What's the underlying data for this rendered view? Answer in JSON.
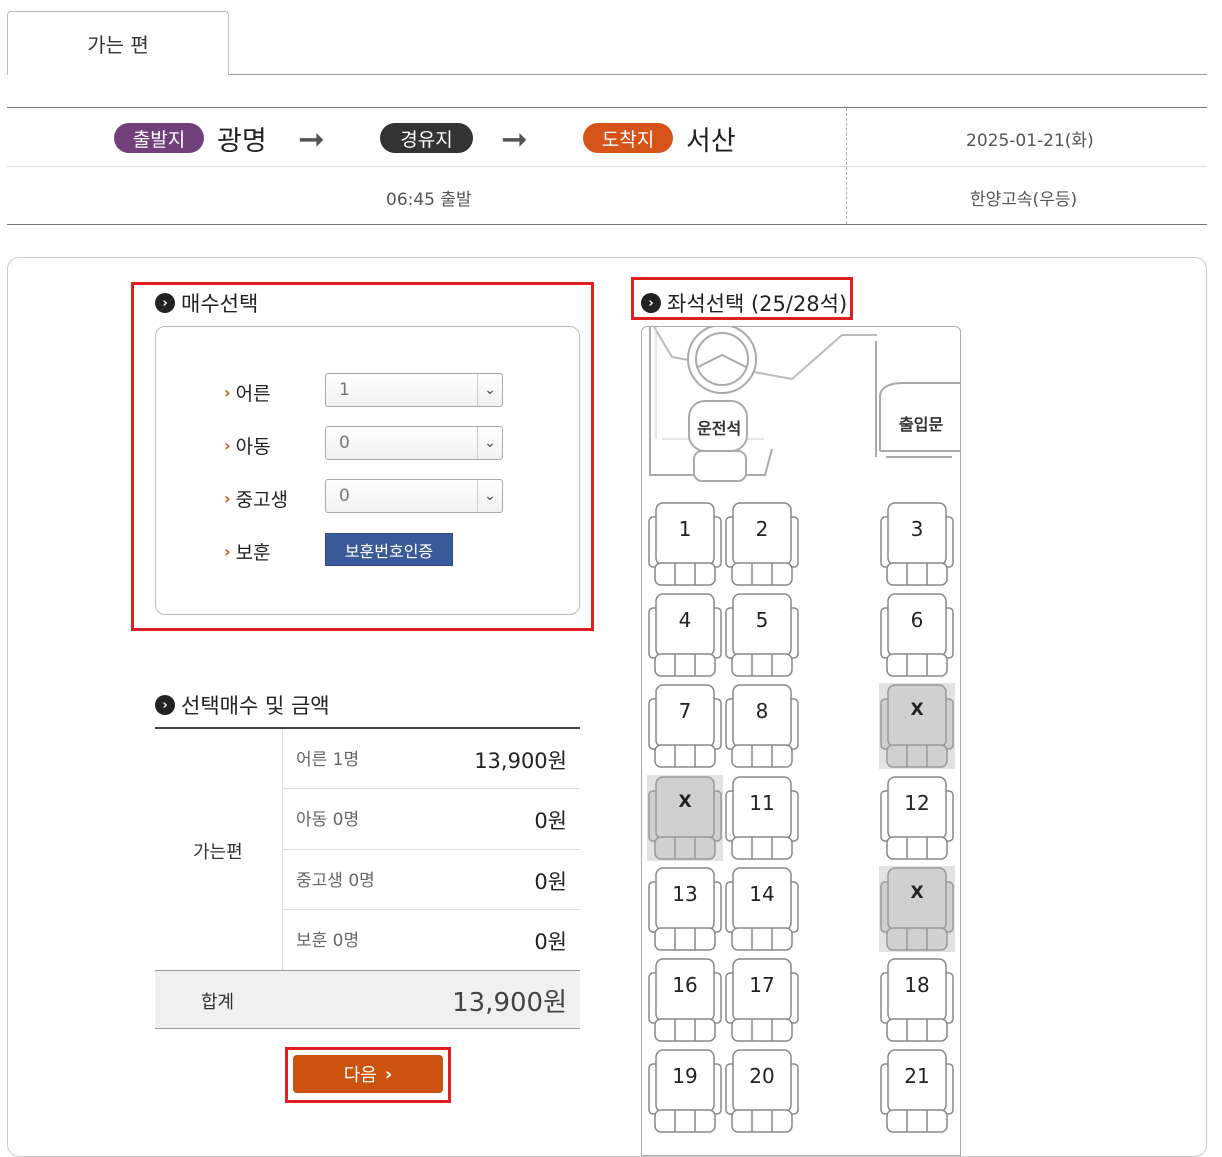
{
  "tab": {
    "label": "가는 편"
  },
  "route": {
    "departure_badge": "출발지",
    "departure": "광명",
    "via_badge": "경유지",
    "arrival_badge": "도착지",
    "arrival": "서산",
    "date": "2025-01-21(화)",
    "time": "06:45 출발",
    "company": "한양고속(우등)",
    "arrow": "➞"
  },
  "quantity": {
    "title": "매수선택",
    "rows": [
      {
        "label": "어른",
        "value": "1"
      },
      {
        "label": "아동",
        "value": "0"
      },
      {
        "label": "중고생",
        "value": "0"
      }
    ],
    "veteran_label": "보훈",
    "veteran_button": "보훈번호인증"
  },
  "summary": {
    "title": "선택매수 및 금액",
    "group": "가는편",
    "rows": [
      {
        "label": "어른 1명",
        "value": "13,900원"
      },
      {
        "label": "아동 0명",
        "value": "0원"
      },
      {
        "label": "중고생 0명",
        "value": "0원"
      },
      {
        "label": "보훈 0명",
        "value": "0원"
      }
    ],
    "total_label": "합계",
    "total_value": "13,900원",
    "next_button": "다음"
  },
  "seats": {
    "title": "좌석선택 (25/28석)",
    "driver_label": "운전석",
    "door_label": "출입문",
    "list": [
      {
        "label": "1",
        "status": "available"
      },
      {
        "label": "2",
        "status": "available"
      },
      {
        "label": "3",
        "status": "available"
      },
      {
        "label": "4",
        "status": "available"
      },
      {
        "label": "5",
        "status": "available"
      },
      {
        "label": "6",
        "status": "available"
      },
      {
        "label": "7",
        "status": "available"
      },
      {
        "label": "8",
        "status": "available"
      },
      {
        "label": "X",
        "status": "taken"
      },
      {
        "label": "X",
        "status": "taken"
      },
      {
        "label": "11",
        "status": "available"
      },
      {
        "label": "12",
        "status": "available"
      },
      {
        "label": "13",
        "status": "available"
      },
      {
        "label": "14",
        "status": "available"
      },
      {
        "label": "X",
        "status": "taken"
      },
      {
        "label": "16",
        "status": "available"
      },
      {
        "label": "17",
        "status": "available"
      },
      {
        "label": "18",
        "status": "available"
      },
      {
        "label": "19",
        "status": "available"
      },
      {
        "label": "20",
        "status": "available"
      },
      {
        "label": "21",
        "status": "available"
      }
    ]
  },
  "colors": {
    "departure": "#71407a",
    "via": "#333333",
    "arrival": "#d6531a",
    "next_button": "#cc5210",
    "veteran_button": "#3b5a9a",
    "highlight": "#e02020"
  }
}
